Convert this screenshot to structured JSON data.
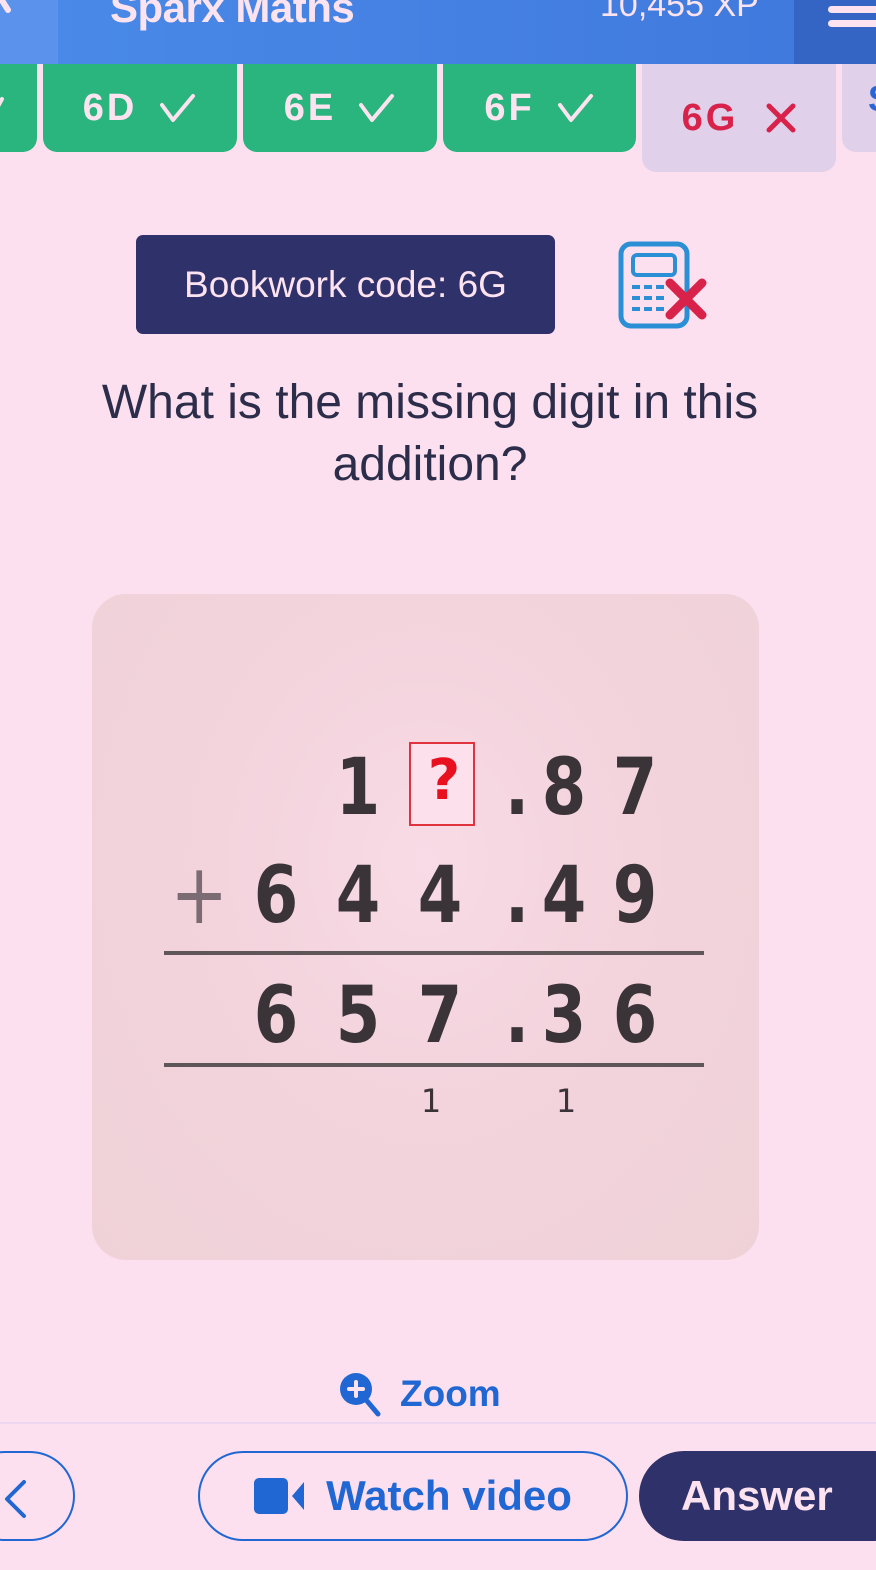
{
  "header": {
    "title": "Sparx Maths",
    "xp": "10,455 XP"
  },
  "tabs": [
    {
      "label": "",
      "status": "correct"
    },
    {
      "label": "6D",
      "status": "correct"
    },
    {
      "label": "6E",
      "status": "correct"
    },
    {
      "label": "6F",
      "status": "correct"
    },
    {
      "label": "6G",
      "status": "incorrect",
      "current": true
    },
    {
      "label": "S",
      "status": "unanswered"
    }
  ],
  "bookwork": {
    "label": "Bookwork code: 6G",
    "calculator": "not-allowed"
  },
  "question": {
    "text": "What is the missing digit in this addition?"
  },
  "figure": {
    "operator": "+",
    "row1": [
      "1",
      "?",
      ".",
      "8",
      "7"
    ],
    "row2": [
      "6",
      "4",
      "4",
      ".",
      "4",
      "9"
    ],
    "result": [
      "6",
      "5",
      "7",
      ".",
      "3",
      "6"
    ],
    "carries": [
      "1",
      "1"
    ],
    "missing_symbol": "?"
  },
  "actions": {
    "zoom_label": "Zoom",
    "watch_video_label": "Watch video",
    "answer_label": "Answer"
  },
  "colors": {
    "header_blue": "#4a8ae8",
    "tab_green": "#2ab57e",
    "tab_current": "#e1d0ea",
    "error_red": "#d8224a",
    "navy": "#2f316b",
    "link_blue": "#2067d4",
    "background": "#fde0ef"
  }
}
